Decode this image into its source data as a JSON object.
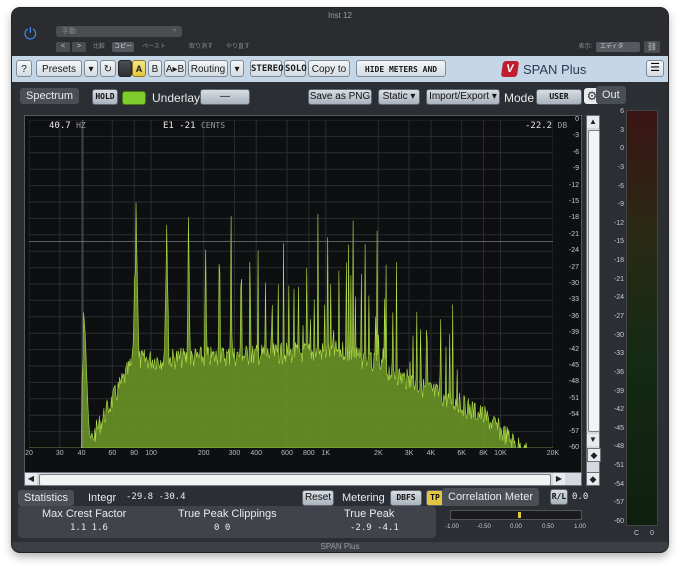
{
  "window": {
    "title": "Inst 12",
    "footer": "SPAN Plus"
  },
  "host_bar": {
    "preset_placeholder": "手動",
    "nav_prev": "<",
    "nav_next": ">",
    "compare_label": "比較",
    "copy_label": "コピー",
    "paste_label": "ペースト",
    "undo_label": "取り消す",
    "redo_label": "やり直す",
    "display_label": "表示:",
    "display_value": "エディタ"
  },
  "toolbar": {
    "help": "?",
    "presets": "Presets",
    "presets_arrow": "▾",
    "reset_icon": "↻",
    "a": "A",
    "b": "B",
    "ab": "A▸B",
    "routing": "Routing",
    "routing_arrow": "▾",
    "stereo": "STEREO",
    "solo": "SOLO",
    "copy_to": "Copy to",
    "hide_meters": "HIDE METERS AND STATS",
    "logo_mark": "V",
    "logo_text": "SPAN Plus",
    "menu_icon": "☰"
  },
  "spectrum": {
    "label": "Spectrum",
    "hold": "HOLD",
    "underlay_label": "Underlay",
    "underlay_value": "—",
    "save_png": "Save as PNG",
    "static": "Static ▾",
    "import_export": "Import/Export ▾",
    "mode_label": "Mode",
    "mode_value": "USER",
    "freq_readout": "40.7",
    "freq_unit": "HZ",
    "note_readout": "E1  -21",
    "note_unit": "CENTS",
    "db_readout": "-22.2",
    "db_unit": "DB",
    "db_ticks": [
      "0",
      "-3",
      "-6",
      "-9",
      "-12",
      "-15",
      "-18",
      "-21",
      "-24",
      "-27",
      "-30",
      "-33",
      "-36",
      "-39",
      "-42",
      "-45",
      "-48",
      "-51",
      "-54",
      "-57",
      "-60"
    ],
    "freq_ticks": [
      "20",
      "30",
      "40",
      "60",
      "80",
      "100",
      "200",
      "300",
      "400",
      "600",
      "800",
      "1K",
      "2K",
      "3K",
      "4K",
      "6K",
      "8K",
      "10K",
      "20K"
    ]
  },
  "out_meter": {
    "label": "Out",
    "ticks": [
      "6",
      "3",
      "0",
      "-3",
      "-6",
      "-9",
      "-12",
      "-15",
      "-18",
      "-21",
      "-24",
      "-27",
      "-30",
      "-33",
      "-36",
      "-39",
      "-42",
      "-45",
      "-48",
      "-51",
      "-54",
      "-57",
      "-60"
    ],
    "channel_c": "C",
    "channel_zero": "0"
  },
  "statistics": {
    "label": "Statistics",
    "integr_label": "Integr",
    "integr_values": "-29.8  -30.4",
    "reset": "Reset",
    "metering_label": "Metering",
    "dbfs": "DBFS",
    "tp": "TP",
    "max_crest_label": "Max Crest Factor",
    "max_crest_values": "1.1   1.6",
    "tp_clippings_label": "True Peak Clippings",
    "tp_clippings_values": "0      0",
    "true_peak_label": "True Peak",
    "true_peak_values": "-2.9  -4.1"
  },
  "correlation": {
    "label": "Correlation Meter",
    "rl": "R/L",
    "value": "0.0",
    "needle_position": 0.52,
    "ticks": [
      "-1.00",
      "-0.50",
      "0.00",
      "0.50",
      "1.00"
    ]
  },
  "colors": {
    "spectrum_fill": "#6f9a27",
    "spectrum_line": "#b4e04a",
    "accent_hold": "#7fcc2e",
    "tp_button": "#e6c640"
  }
}
